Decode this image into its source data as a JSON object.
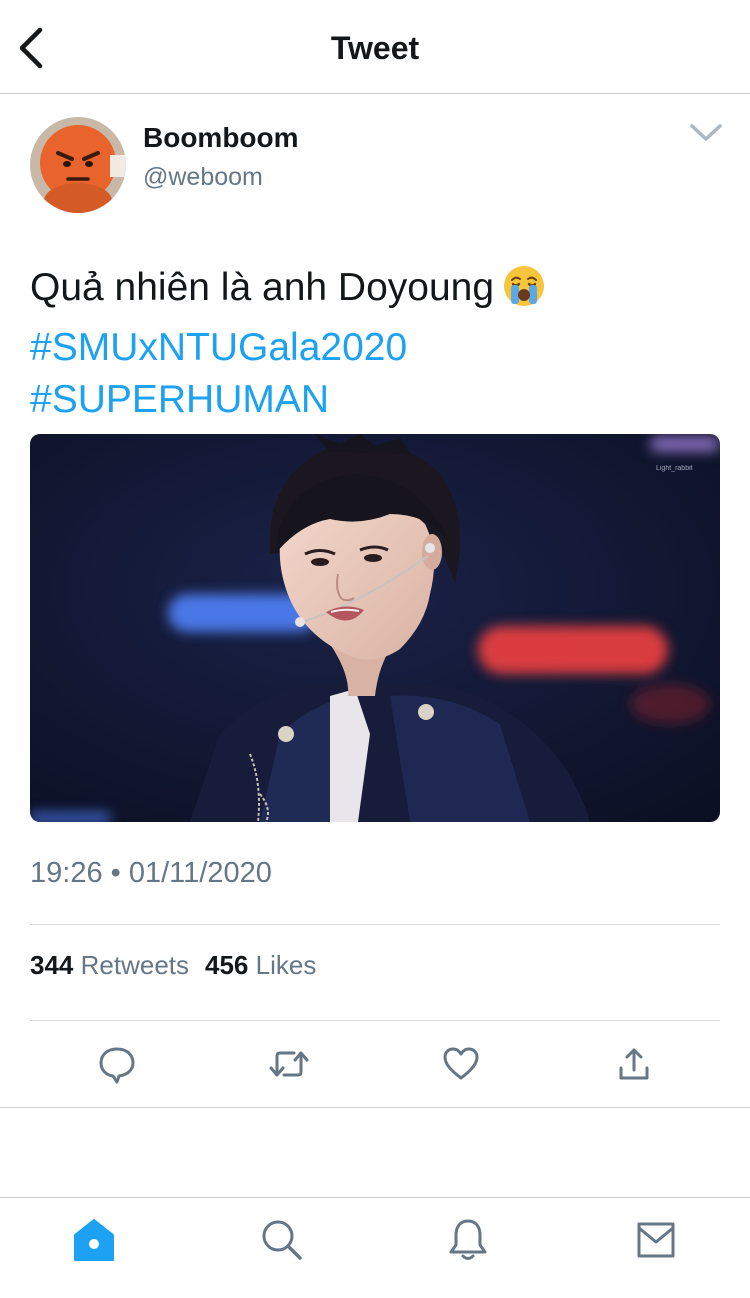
{
  "header": {
    "title": "Tweet",
    "back_icon": "chevron-left-icon"
  },
  "tweet": {
    "author": {
      "name": "Boomboom",
      "handle": "@weboom"
    },
    "text": {
      "line1": "Quả nhiên là anh Doyoung",
      "emoji": "loudly-crying-face-emoji",
      "hashtags": [
        "#SMUxNTUGala2020",
        "#SUPERHUMAN"
      ]
    },
    "media_watermark": "Light_rabbit",
    "timestamp": "19:26 • 01/11/2020",
    "stats": {
      "retweets_count": "344",
      "retweets_label": "Retweets",
      "likes_count": "456",
      "likes_label": "Likes"
    }
  },
  "actions": [
    {
      "name": "reply",
      "icon": "speech-bubble-icon"
    },
    {
      "name": "retweet",
      "icon": "retweet-arrows-icon"
    },
    {
      "name": "like",
      "icon": "heart-icon"
    },
    {
      "name": "share",
      "icon": "share-upload-icon"
    }
  ],
  "tabbar": [
    {
      "name": "home",
      "icon": "home-icon",
      "active": true
    },
    {
      "name": "search",
      "icon": "search-icon",
      "active": false
    },
    {
      "name": "notifications",
      "icon": "bell-icon",
      "active": false
    },
    {
      "name": "messages",
      "icon": "envelope-icon",
      "active": false
    }
  ],
  "colors": {
    "accent": "#1da1f2",
    "text": "#14171a",
    "muted": "#657786",
    "divider": "#ccd0d4",
    "icon_gray": "#657786"
  }
}
